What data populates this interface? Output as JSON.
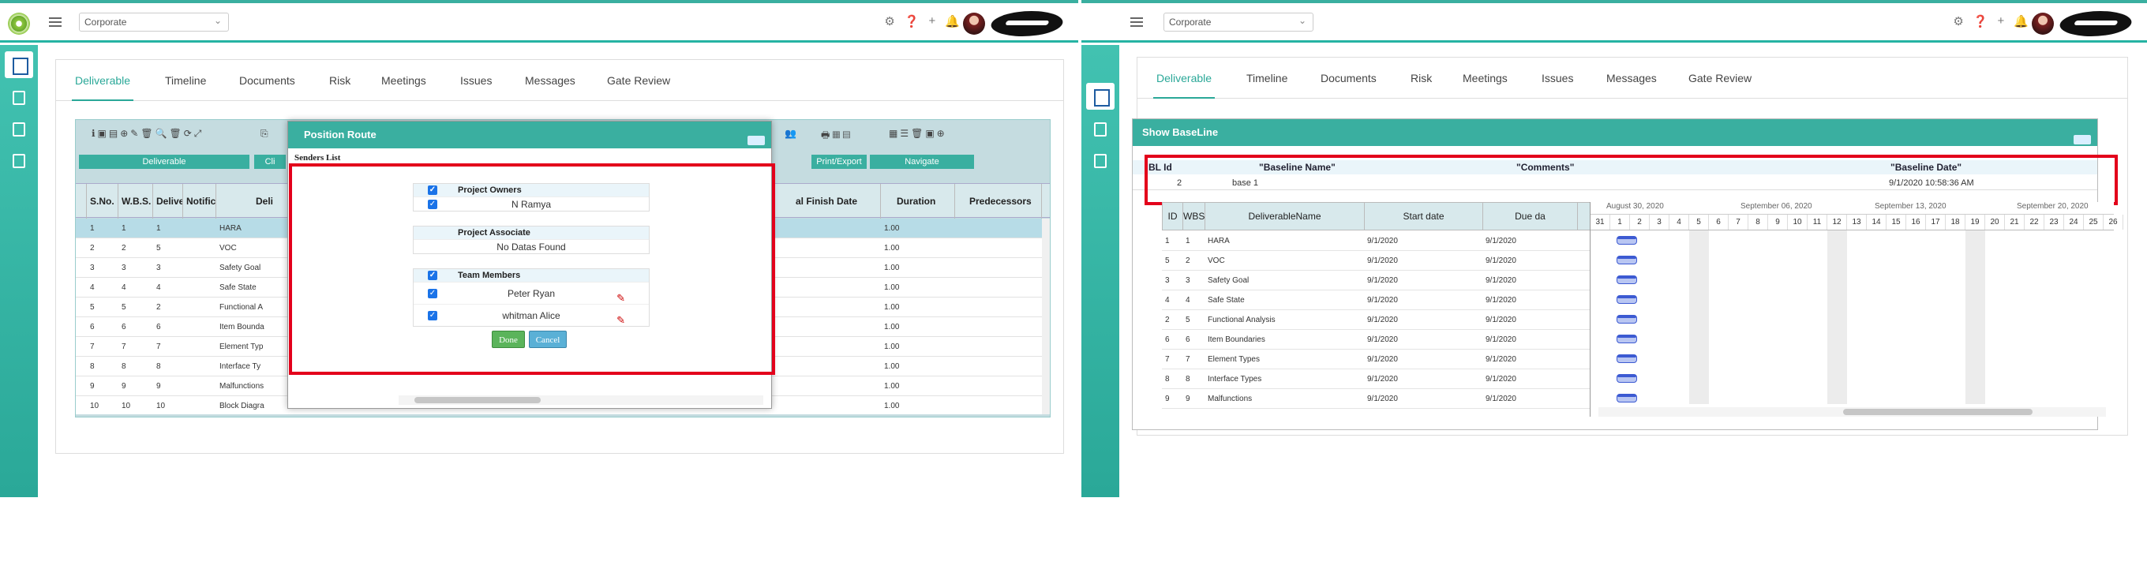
{
  "header": {
    "org_select": "Corporate",
    "icons": [
      "gear-icon",
      "help-icon",
      "plus-icon",
      "bell-icon"
    ]
  },
  "tabs": [
    "Deliverable",
    "Timeline",
    "Documents",
    "Risk",
    "Meetings",
    "Issues",
    "Messages",
    "Gate Review"
  ],
  "left": {
    "toolbar_groups": [
      "Deliverable",
      "Cli",
      "Print/Export",
      "Navigate"
    ],
    "columns": [
      "S.No.",
      "W.B.S.",
      "Delive",
      "Notific",
      "Deli",
      "al Finish Date",
      "Duration",
      "Predecessors"
    ],
    "rows": [
      {
        "sno": "1",
        "wbs": "1",
        "deliv": "1",
        "name": "HARA",
        "duration": "1.00"
      },
      {
        "sno": "2",
        "wbs": "2",
        "deliv": "5",
        "name": "VOC",
        "duration": "1.00"
      },
      {
        "sno": "3",
        "wbs": "3",
        "deliv": "3",
        "name": "Safety Goal",
        "duration": "1.00"
      },
      {
        "sno": "4",
        "wbs": "4",
        "deliv": "4",
        "name": "Safe State",
        "duration": "1.00"
      },
      {
        "sno": "5",
        "wbs": "5",
        "deliv": "2",
        "name": "Functional A",
        "duration": "1.00"
      },
      {
        "sno": "6",
        "wbs": "6",
        "deliv": "6",
        "name": "Item Bounda",
        "duration": "1.00"
      },
      {
        "sno": "7",
        "wbs": "7",
        "deliv": "7",
        "name": "Element Typ",
        "duration": "1.00"
      },
      {
        "sno": "8",
        "wbs": "8",
        "deliv": "8",
        "name": "Interface Ty",
        "duration": "1.00"
      },
      {
        "sno": "9",
        "wbs": "9",
        "deliv": "9",
        "name": "Malfunctions",
        "duration": "1.00"
      },
      {
        "sno": "10",
        "wbs": "10",
        "deliv": "10",
        "name": "Block Diagra",
        "duration": "1.00"
      }
    ],
    "modal": {
      "title": "Position Route",
      "senders_label": "Senders List",
      "sections": [
        {
          "title": "Project Owners",
          "members": [
            {
              "name": "N Ramya",
              "pen": false
            }
          ]
        },
        {
          "title": "Project Associate",
          "empty": "No Datas Found",
          "members": []
        },
        {
          "title": "Team Members",
          "members": [
            {
              "name": "Peter Ryan",
              "pen": true
            },
            {
              "name": "whitman Alice",
              "pen": true
            }
          ]
        }
      ],
      "done_label": "Done",
      "cancel_label": "Cancel"
    }
  },
  "right": {
    "panel_title": "Show BaseLine",
    "baseline_headers": [
      "BL Id",
      "\"Baseline Name\"",
      "\"Comments\"",
      "\"Baseline Date\""
    ],
    "baseline_row": {
      "id": "2",
      "name": "base 1",
      "comments": "",
      "date": "9/1/2020 10:58:36 AM"
    },
    "columns": [
      "ID",
      "WBS",
      "DeliverableName",
      "Start date",
      "Due da"
    ],
    "rows": [
      {
        "id": "1",
        "wbs": "1",
        "name": "HARA",
        "start": "9/1/2020",
        "due": "9/1/2020"
      },
      {
        "id": "5",
        "wbs": "2",
        "name": "VOC",
        "start": "9/1/2020",
        "due": "9/1/2020"
      },
      {
        "id": "3",
        "wbs": "3",
        "name": "Safety Goal",
        "start": "9/1/2020",
        "due": "9/1/2020"
      },
      {
        "id": "4",
        "wbs": "4",
        "name": "Safe State",
        "start": "9/1/2020",
        "due": "9/1/2020"
      },
      {
        "id": "2",
        "wbs": "5",
        "name": "Functional Analysis",
        "start": "9/1/2020",
        "due": "9/1/2020"
      },
      {
        "id": "6",
        "wbs": "6",
        "name": "Item Boundaries",
        "start": "9/1/2020",
        "due": "9/1/2020"
      },
      {
        "id": "7",
        "wbs": "7",
        "name": "Element Types",
        "start": "9/1/2020",
        "due": "9/1/2020"
      },
      {
        "id": "8",
        "wbs": "8",
        "name": "Interface Types",
        "start": "9/1/2020",
        "due": "9/1/2020"
      },
      {
        "id": "9",
        "wbs": "9",
        "name": "Malfunctions",
        "start": "9/1/2020",
        "due": "9/1/2020"
      }
    ],
    "gantt_weeks": [
      "August 30, 2020",
      "September 06, 2020",
      "September 13, 2020",
      "September 20, 2020"
    ],
    "gantt_days": [
      "31",
      "1",
      "2",
      "3",
      "4",
      "5",
      "6",
      "7",
      "8",
      "9",
      "10",
      "11",
      "12",
      "13",
      "14",
      "15",
      "16",
      "17",
      "18",
      "19",
      "20",
      "21",
      "22",
      "23",
      "24",
      "25",
      "26"
    ]
  }
}
